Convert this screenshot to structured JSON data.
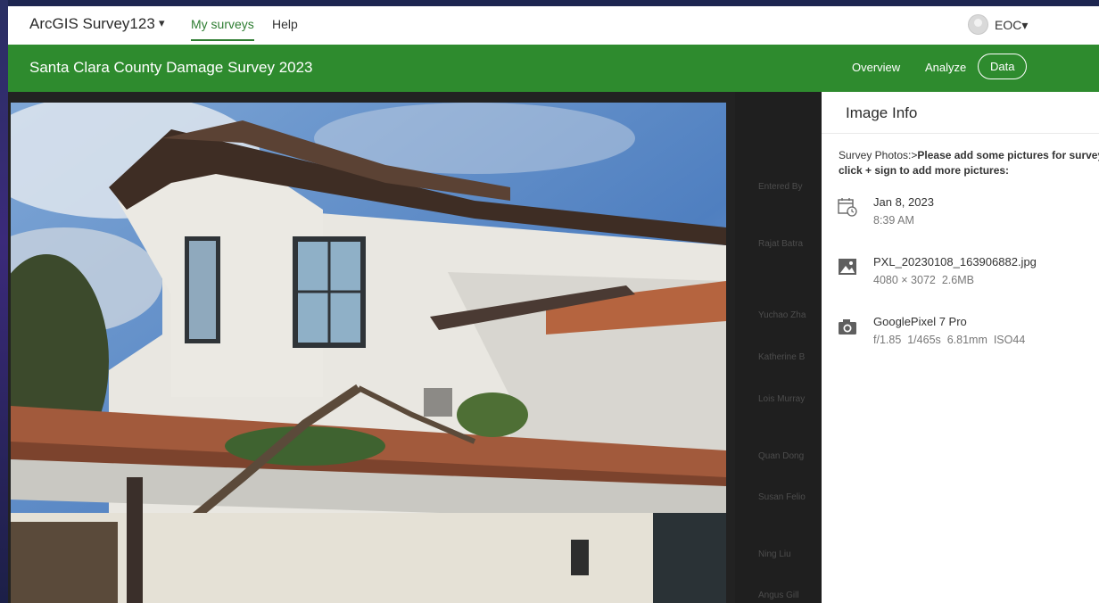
{
  "app": {
    "title": "ArcGIS Survey123",
    "caret": "▾",
    "nav": [
      {
        "label": "My surveys",
        "active": true
      },
      {
        "label": "Help",
        "active": false
      }
    ],
    "user": "EOC▾"
  },
  "survey": {
    "title": "Santa Clara County Damage Survey 2023",
    "tabs": [
      {
        "label": "Overview"
      },
      {
        "label": "Analyze"
      },
      {
        "label": "Data",
        "active": true
      }
    ],
    "colors": {
      "brand_green": "#2e8b2e",
      "active_nav": "#2e7d32"
    }
  },
  "viewer": {
    "tools": [
      "zoom-in-icon",
      "download-icon"
    ],
    "background_rows": [
      "Entered By",
      "Rajat Batra",
      "Yuchao Zha",
      "Katherine B",
      "Lois Murray",
      "Quan Dong",
      "Susan Felio",
      "Ning Liu",
      "Angus Gill"
    ]
  },
  "image_info": {
    "title": "Image Info",
    "question_prefix": "Survey Photos:>",
    "question_bold": "Please add some pictures for survey, click + sign to add more pictures:",
    "date": "Jan 8, 2023",
    "time": "8:39 AM",
    "filename": "PXL_20230108_163906882.jpg",
    "dimensions": "4080 × 3072",
    "filesize": "2.6MB",
    "camera": "GooglePixel 7 Pro",
    "exif": {
      "aperture": "f/1.85",
      "shutter": "1/465s",
      "focal": "6.81mm",
      "iso": "ISO44"
    }
  }
}
